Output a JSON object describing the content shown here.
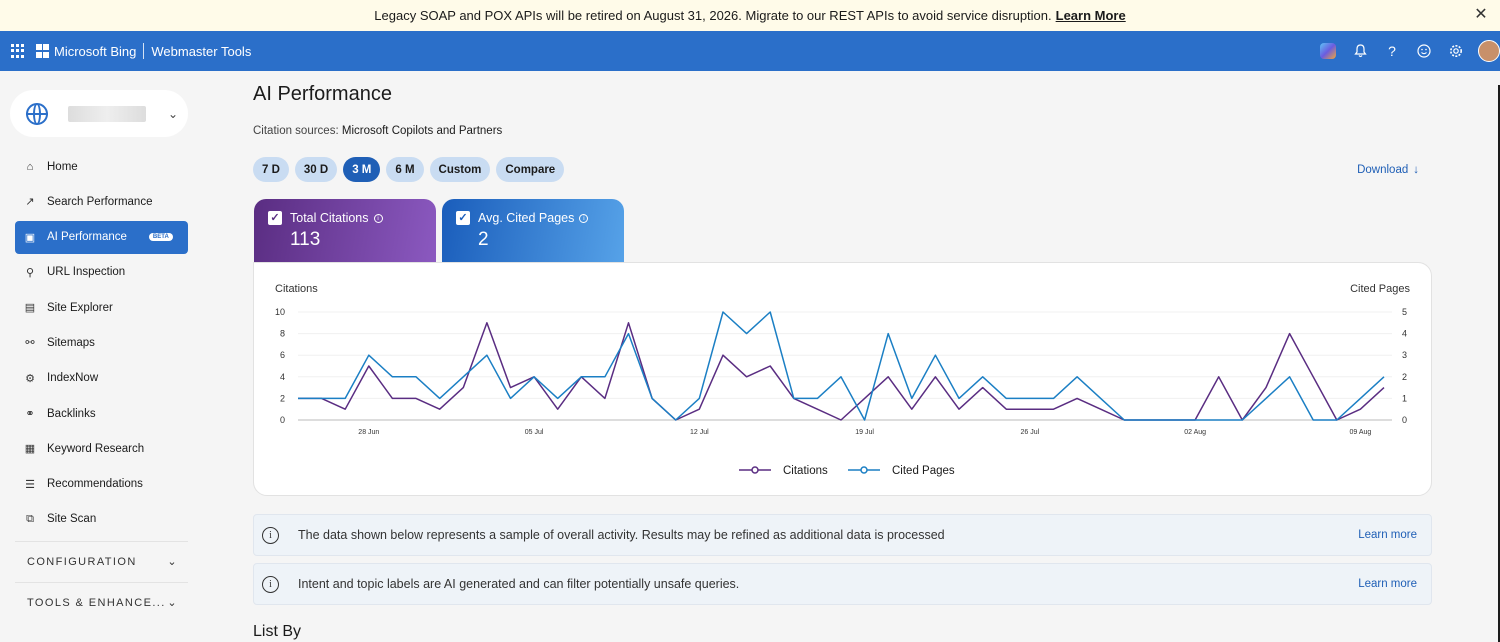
{
  "banner": {
    "text": "Legacy SOAP and POX APIs will be retired on August 31, 2026. Migrate to our REST APIs to avoid service disruption.",
    "link": "Learn More",
    "close_icon": "close-icon"
  },
  "header": {
    "brand": "Microsoft Bing",
    "product": "Webmaster Tools",
    "icons": [
      "waffle-icon",
      "copilot-icon",
      "bell-icon",
      "help-icon",
      "smiley-icon",
      "gear-icon",
      "avatar"
    ]
  },
  "sidebar": {
    "items": [
      {
        "label": "Home",
        "icon": "home-icon"
      },
      {
        "label": "Search Performance",
        "icon": "trend-icon"
      },
      {
        "label": "AI Performance",
        "icon": "ai-icon",
        "badge": "BETA",
        "active": true
      },
      {
        "label": "URL Inspection",
        "icon": "magnifier-icon"
      },
      {
        "label": "Site Explorer",
        "icon": "page-icon"
      },
      {
        "label": "Sitemaps",
        "icon": "sitemap-icon"
      },
      {
        "label": "IndexNow",
        "icon": "gear-icon"
      },
      {
        "label": "Backlinks",
        "icon": "link-icon"
      },
      {
        "label": "Keyword Research",
        "icon": "document-icon"
      },
      {
        "label": "Recommendations",
        "icon": "checklist-icon"
      },
      {
        "label": "Site Scan",
        "icon": "scan-icon"
      }
    ],
    "sections": [
      "CONFIGURATION",
      "TOOLS & ENHANCE..."
    ]
  },
  "main": {
    "title": "AI Performance",
    "citation_label": "Citation sources:",
    "citation_value": "Microsoft Copilots and Partners",
    "ranges": [
      "7 D",
      "30 D",
      "3 M",
      "6 M",
      "Custom",
      "Compare"
    ],
    "active_range": "3 M",
    "download": "Download",
    "kpis": {
      "citations": {
        "label": "Total Citations",
        "value": "113"
      },
      "pages": {
        "label": "Avg. Cited Pages",
        "value": "2"
      }
    },
    "notices": [
      {
        "text": "The data shown below represents a sample of overall activity. Results may be refined as additional data is processed",
        "link": "Learn more"
      },
      {
        "text": "Intent and topic labels are AI generated and can filter potentially unsafe queries.",
        "link": "Learn more"
      }
    ],
    "list_by": "List By"
  },
  "chart_data": {
    "type": "line",
    "ylabel_left": "Citations",
    "ylabel_right": "Cited Pages",
    "yticks_left": [
      0,
      2,
      4,
      6,
      8,
      10
    ],
    "yticks_right": [
      0,
      1,
      2,
      3,
      4,
      5
    ],
    "ylim_left": [
      0,
      10
    ],
    "ylim_right": [
      0,
      5
    ],
    "xtick_labels": [
      "28 Jun",
      "05 Jul",
      "12 Jul",
      "19 Jul",
      "26 Jul",
      "02 Aug",
      "09 Aug"
    ],
    "xtick_index": [
      3,
      10,
      17,
      24,
      31,
      38,
      45
    ],
    "legend_position": "bottom",
    "series": [
      {
        "name": "Citations",
        "axis": "left",
        "color": "#5a2d82",
        "values": [
          2,
          2,
          1,
          5,
          2,
          2,
          1,
          3,
          9,
          3,
          4,
          1,
          4,
          2,
          9,
          2,
          0,
          1,
          6,
          4,
          5,
          2,
          1,
          0,
          2,
          4,
          1,
          4,
          1,
          3,
          1,
          1,
          1,
          2,
          1,
          0,
          0,
          0,
          0,
          4,
          0,
          3,
          8,
          4,
          0,
          1,
          3
        ]
      },
      {
        "name": "Cited Pages",
        "axis": "right",
        "color": "#1b7fc4",
        "values": [
          1,
          1,
          1,
          3,
          2,
          2,
          1,
          2,
          3,
          1,
          2,
          1,
          2,
          2,
          4,
          1,
          0,
          1,
          5,
          4,
          5,
          1,
          1,
          2,
          0,
          4,
          1,
          3,
          1,
          2,
          1,
          1,
          1,
          2,
          1,
          0,
          0,
          0,
          0,
          0,
          0,
          1,
          2,
          0,
          0,
          1,
          2
        ]
      }
    ]
  }
}
